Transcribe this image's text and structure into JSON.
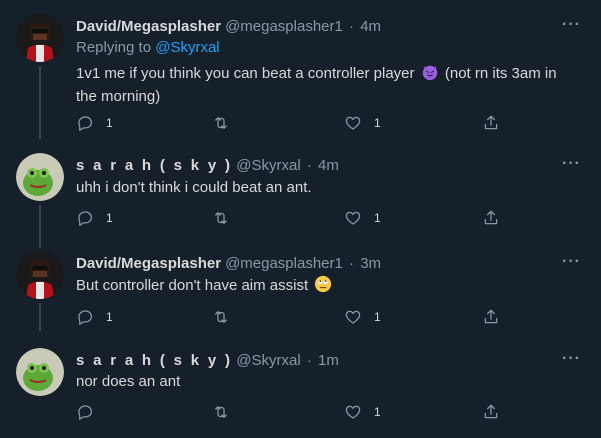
{
  "colors": {
    "background": "#15202b",
    "text": "#d9d9d9",
    "secondary": "#8899a6",
    "link": "#1da1f2",
    "thread_line": "#38444d"
  },
  "tweets": [
    {
      "name": "David/Megasplasher",
      "handle": "@megasplasher1",
      "dot": "·",
      "time": "4m",
      "replying_prefix": "Replying to",
      "replying_link": "@Skyrxal",
      "text_line1": "1v1 me if you think you can beat a controller player",
      "text_line1_after": "(not rn its 3am in",
      "text_line2": "the morning)",
      "emoji": "smiling-devil",
      "reply_count": "1",
      "like_count": "1"
    },
    {
      "name": "s a r a h ( s k y )",
      "handle": "@Skyrxal",
      "dot": "·",
      "time": "4m",
      "text": "uhh i don't think i could beat an ant.",
      "reply_count": "1",
      "like_count": "1"
    },
    {
      "name": "David/Megasplasher",
      "handle": "@megasplasher1",
      "dot": "·",
      "time": "3m",
      "text": "But controller don't have aim assist",
      "emoji": "face-with-rolling-eyes",
      "reply_count": "1",
      "like_count": "1"
    },
    {
      "name": "s a r a h ( s k y )",
      "handle": "@Skyrxal",
      "dot": "·",
      "time": "1m",
      "text": "nor does an ant",
      "like_count": "1"
    }
  ]
}
